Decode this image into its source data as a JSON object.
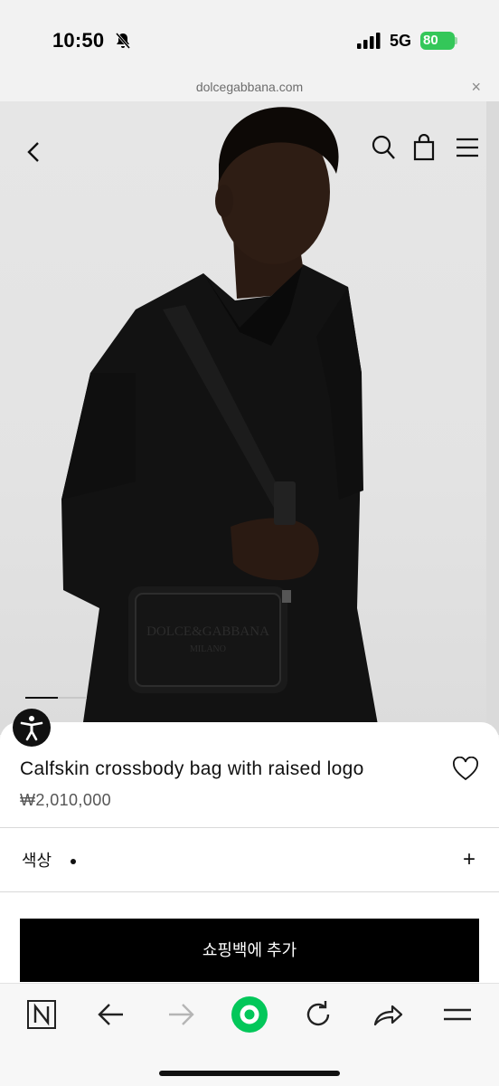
{
  "status_bar": {
    "time": "10:50",
    "network": "5G",
    "battery": "80",
    "silent_icon": "bell-slash-icon",
    "signal_icon": "cellular-signal-icon"
  },
  "browser": {
    "url": "dolcegabbana.com",
    "close_label": "×"
  },
  "header_icons": [
    "back-chevron-icon",
    "search-icon",
    "shopping-bag-icon",
    "hamburger-menu-icon"
  ],
  "gallery": {
    "total_slides_indicator": "active-first"
  },
  "product": {
    "title": "Calfskin crossbody bag with raised logo",
    "price": "₩2,010,000",
    "favorite_icon": "heart-outline-icon"
  },
  "color_selector": {
    "label": "색상",
    "expand_symbol": "+"
  },
  "cta": {
    "add_to_bag_label": "쇼핑백에 추가"
  },
  "toolbar": {
    "items": [
      "naver-n-icon",
      "back-arrow-icon",
      "forward-arrow-icon",
      "green-home-icon",
      "reload-icon",
      "share-icon",
      "menu-icon"
    ]
  },
  "colors": {
    "accent_green": "#03c75a",
    "battery_green": "#34c759",
    "cta_black": "#000000"
  }
}
